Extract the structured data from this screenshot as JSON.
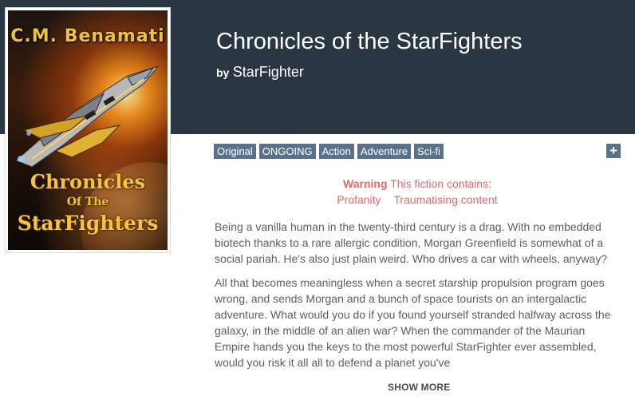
{
  "cover": {
    "author_text": "C.M. Benamati",
    "title_line1": "Chronicles",
    "title_line2": "Of The",
    "title_line3": "StarFighters"
  },
  "fiction": {
    "title": "Chronicles of the StarFighters",
    "by_label": "by",
    "author": "StarFighter"
  },
  "tags": [
    "Original",
    "ONGOING",
    "Action",
    "Adventure",
    "Sci-fi"
  ],
  "add_button_label": "+",
  "warning": {
    "label": "Warning",
    "text": "This fiction contains:",
    "items": [
      "Profanity",
      "Traumatising content"
    ]
  },
  "description": [
    "Being a vanilla human in the twenty-third century is a drag. With no embedded biotech thanks to a rare allergic condition, Morgan Greenfield is somewhat of a social pariah. He's also just plain weird. Who drives a car with wheels, anyway?",
    "All that becomes meaningless when a secret starship propulsion program goes wrong, and sends Morgan and a bunch of space tourists on an intergalactic adventure. What would you do if you found yourself stranded halfway across the galaxy, in the middle of an alien war? When the commander of the Maurian Empire hands you the keys to the most powerful StarFighter ever assembled, would you risk it all all to defend a planet you've"
  ],
  "show_more_label": "SHOW MORE",
  "colors": {
    "header_bg": "#2b3643",
    "tag_bg": "#5a7289",
    "warning": "#e26a6a",
    "text": "#5e5e5e"
  }
}
